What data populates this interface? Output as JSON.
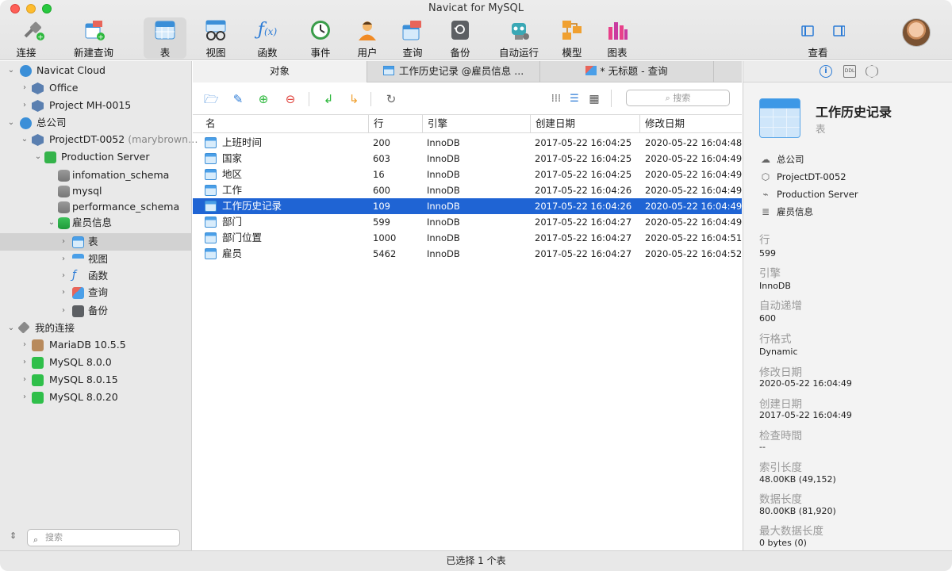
{
  "app": {
    "title": "Navicat for MySQL"
  },
  "toolbar": {
    "connect": "连接",
    "new_query": "新建查询",
    "table": "表",
    "view": "视图",
    "function": "函数",
    "event": "事件",
    "user": "用户",
    "query": "查询",
    "backup": "备份",
    "automation": "自动运行",
    "model": "模型",
    "chart": "图表",
    "view_mode": "查看"
  },
  "sidebar": {
    "tree": [
      {
        "label": "Navicat Cloud",
        "icon": "cloud-icon"
      },
      {
        "label": "Office",
        "icon": "project-icon"
      },
      {
        "label": "Project MH-0015",
        "icon": "project-icon"
      },
      {
        "label": "总公司",
        "icon": "cloud-icon"
      },
      {
        "label": "ProjectDT-0052",
        "sub": "(marybrown…",
        "icon": "project-icon"
      },
      {
        "label": "Production Server",
        "icon": "server-icon"
      },
      {
        "label": "infomation_schema",
        "icon": "database-icon"
      },
      {
        "label": "mysql",
        "icon": "database-icon"
      },
      {
        "label": "performance_schema",
        "icon": "database-icon"
      },
      {
        "label": "雇员信息",
        "icon": "database-icon"
      },
      {
        "label": "表",
        "icon": "table-icon"
      },
      {
        "label": "视图",
        "icon": "view-icon"
      },
      {
        "label": "函数",
        "icon": "function-icon"
      },
      {
        "label": "查询",
        "icon": "query-icon"
      },
      {
        "label": "备份",
        "icon": "backup-icon"
      },
      {
        "label": "我的连接",
        "icon": "connection-icon"
      },
      {
        "label": "MariaDB 10.5.5",
        "icon": "mariadb-icon"
      },
      {
        "label": "MySQL 8.0.0",
        "icon": "mysql-icon"
      },
      {
        "label": "MySQL 8.0.15",
        "icon": "mysql-icon"
      },
      {
        "label": "MySQL 8.0.20",
        "icon": "mysql-icon"
      }
    ],
    "search_placeholder": "搜索"
  },
  "tabs": [
    {
      "label": "对象"
    },
    {
      "label": "工作历史记录 @雇员信息 ..."
    },
    {
      "label": "* 无标题 - 查询"
    }
  ],
  "objbar": {
    "search_placeholder": "搜索"
  },
  "table": {
    "columns": [
      "名",
      "行",
      "引擎",
      "创建日期",
      "修改日期"
    ],
    "rows": [
      {
        "name": "上班时间",
        "rows": "200",
        "engine": "InnoDB",
        "created": "2017-05-22 16:04:25",
        "modified": "2020-05-22 16:04:48"
      },
      {
        "name": "国家",
        "rows": "603",
        "engine": "InnoDB",
        "created": "2017-05-22 16:04:25",
        "modified": "2020-05-22 16:04:49"
      },
      {
        "name": "地区",
        "rows": "16",
        "engine": "InnoDB",
        "created": "2017-05-22 16:04:25",
        "modified": "2020-05-22 16:04:49"
      },
      {
        "name": "工作",
        "rows": "600",
        "engine": "InnoDB",
        "created": "2017-05-22 16:04:26",
        "modified": "2020-05-22 16:04:49"
      },
      {
        "name": "工作历史记录",
        "rows": "109",
        "engine": "InnoDB",
        "created": "2017-05-22 16:04:26",
        "modified": "2020-05-22 16:04:49"
      },
      {
        "name": "部门",
        "rows": "599",
        "engine": "InnoDB",
        "created": "2017-05-22 16:04:27",
        "modified": "2020-05-22 16:04:49"
      },
      {
        "name": "部门位置",
        "rows": "1000",
        "engine": "InnoDB",
        "created": "2017-05-22 16:04:27",
        "modified": "2020-05-22 16:04:51"
      },
      {
        "name": "雇员",
        "rows": "5462",
        "engine": "InnoDB",
        "created": "2017-05-22 16:04:27",
        "modified": "2020-05-22 16:04:52"
      }
    ]
  },
  "details": {
    "title": "工作历史记录",
    "subtitle": "表",
    "path": [
      "总公司",
      "ProjectDT-0052",
      "Production Server",
      "雇员信息"
    ],
    "props": [
      {
        "label": "行",
        "value": "599"
      },
      {
        "label": "引擎",
        "value": "InnoDB"
      },
      {
        "label": "自动递增",
        "value": "600"
      },
      {
        "label": "行格式",
        "value": "Dynamic"
      },
      {
        "label": "修改日期",
        "value": "2020-05-22 16:04:49"
      },
      {
        "label": "创建日期",
        "value": "2017-05-22 16:04:49"
      },
      {
        "label": "检查時間",
        "value": "--"
      },
      {
        "label": "索引长度",
        "value": "48.00KB (49,152)"
      },
      {
        "label": "数据长度",
        "value": "80.00KB (81,920)"
      },
      {
        "label": "最大数据长度",
        "value": "0 bytes (0)"
      }
    ]
  },
  "status": {
    "text": "已选择 1 个表"
  },
  "colors": {
    "accent": "#1f64d4",
    "table_icon": "#4a9fe8"
  }
}
